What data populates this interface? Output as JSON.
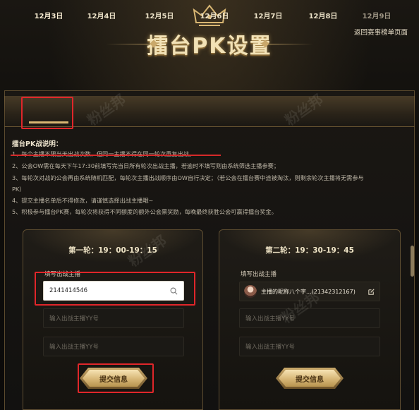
{
  "header": {
    "title": "擂台PK设置",
    "back_link": "返回赛事榜单页面"
  },
  "tabs": [
    {
      "label": "12月3日",
      "active": true
    },
    {
      "label": "12月4日",
      "active": false
    },
    {
      "label": "12月5日",
      "active": false
    },
    {
      "label": "12月6日",
      "active": false
    },
    {
      "label": "12月7日",
      "active": false
    },
    {
      "label": "12月8日",
      "active": false
    },
    {
      "label": "12月9日",
      "active": false
    }
  ],
  "rules": {
    "title": "擂台PK战说明：",
    "items": [
      "1、每个主播不限当天出战次数，但同一主播不得在同一轮次重复出战。",
      "2、公会OW需在每天下午17:30前填写完当日所有轮次出战主播，若逾时不填写则由系统筛选主播参赛；",
      "3、每轮次对战的公会再由系统随机匹配，每轮次主播出战顺序由OW自行决定；（若公会在擂台赛中途被淘汰，则剩余轮次主播将无需参与",
      "PK）",
      "4、提交主播名单后不得修改，请谨慎选择出战主播哦~",
      "5、积极参与擂台PK赛，每轮次将获得不同额度的额外公会票奖励，每晚最终获胜公会可赢得擂台奖金。"
    ]
  },
  "rounds": [
    {
      "title": "第一轮：19：00-19：15",
      "field_label": "填写出战主播",
      "input_value": "2141414546",
      "placeholder_1": "输入出战主播YY号",
      "placeholder_2": "输入出战主播YY号",
      "submit_label": "提交信息"
    },
    {
      "title": "第二轮：19：30-19：45",
      "field_label": "填写出战主播",
      "streamer_name": "主播的昵称八个字...(21342312167)",
      "placeholder_1": "输入出战主播YY号",
      "placeholder_2": "输入出战主播YY号",
      "submit_label": "提交信息"
    }
  ],
  "watermark": "粉丝邦",
  "colors": {
    "gold": "#c9a86a",
    "highlight_red": "#e0262a",
    "background": "#0d0c0a"
  }
}
